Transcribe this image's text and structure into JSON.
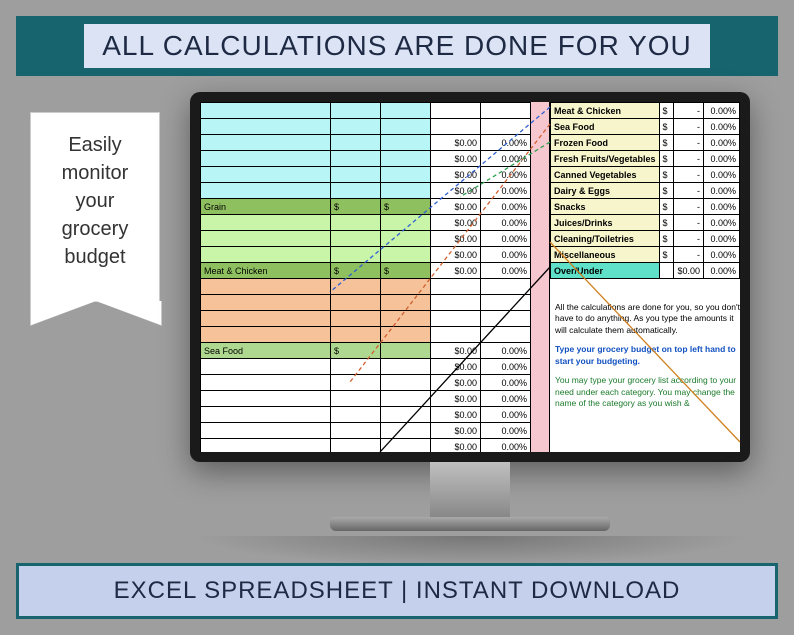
{
  "top_banner": "ALL CALCULATIONS ARE DONE FOR YOU",
  "bottom_banner": "EXCEL SPREADSHEET | INSTANT DOWNLOAD",
  "ribbon": "Easily monitor your grocery budget",
  "left_rows": {
    "grain": "Grain",
    "meat": "Meat & Chicken",
    "sea": "Sea Food",
    "dollar": "$",
    "zero_amt": "$0.00",
    "zero_pct": "0.00%"
  },
  "summary": [
    {
      "label": "Meat & Chicken",
      "cur": "$",
      "dash": "-",
      "pct": "0.00%",
      "bg": "bg-yellow"
    },
    {
      "label": "Sea Food",
      "cur": "$",
      "dash": "-",
      "pct": "0.00%",
      "bg": "bg-yellow"
    },
    {
      "label": "Frozen Food",
      "cur": "$",
      "dash": "-",
      "pct": "0.00%",
      "bg": "bg-yellow"
    },
    {
      "label": "Fresh Fruits/Vegetables",
      "cur": "$",
      "dash": "-",
      "pct": "0.00%",
      "bg": "bg-yellow"
    },
    {
      "label": "Canned Vegetables",
      "cur": "$",
      "dash": "-",
      "pct": "0.00%",
      "bg": "bg-yellow"
    },
    {
      "label": "Dairy & Eggs",
      "cur": "$",
      "dash": "-",
      "pct": "0.00%",
      "bg": "bg-yellow"
    },
    {
      "label": "Snacks",
      "cur": "$",
      "dash": "-",
      "pct": "0.00%",
      "bg": "bg-yellow"
    },
    {
      "label": "Juices/Drinks",
      "cur": "$",
      "dash": "-",
      "pct": "0.00%",
      "bg": "bg-yellow"
    },
    {
      "label": "Cleaning/Toiletries",
      "cur": "$",
      "dash": "-",
      "pct": "0.00%",
      "bg": "bg-yellow"
    },
    {
      "label": "Miscellaneous",
      "cur": "$",
      "dash": "-",
      "pct": "0.00%",
      "bg": "bg-yellow"
    },
    {
      "label": "Over/Under",
      "cur": "",
      "dash": "$0.00",
      "pct": "0.00%",
      "bg": "bg-teal"
    }
  ],
  "info": {
    "p1": "All the calculations are done for you, so you don't have to do anything. As you type the amounts it will calculate them automatically.",
    "p2": "Type your grocery budget on top left hand to start your budgeting.",
    "p3": "You may type your grocery list according to your need under each category. You may change the name of the category as you wish &"
  }
}
